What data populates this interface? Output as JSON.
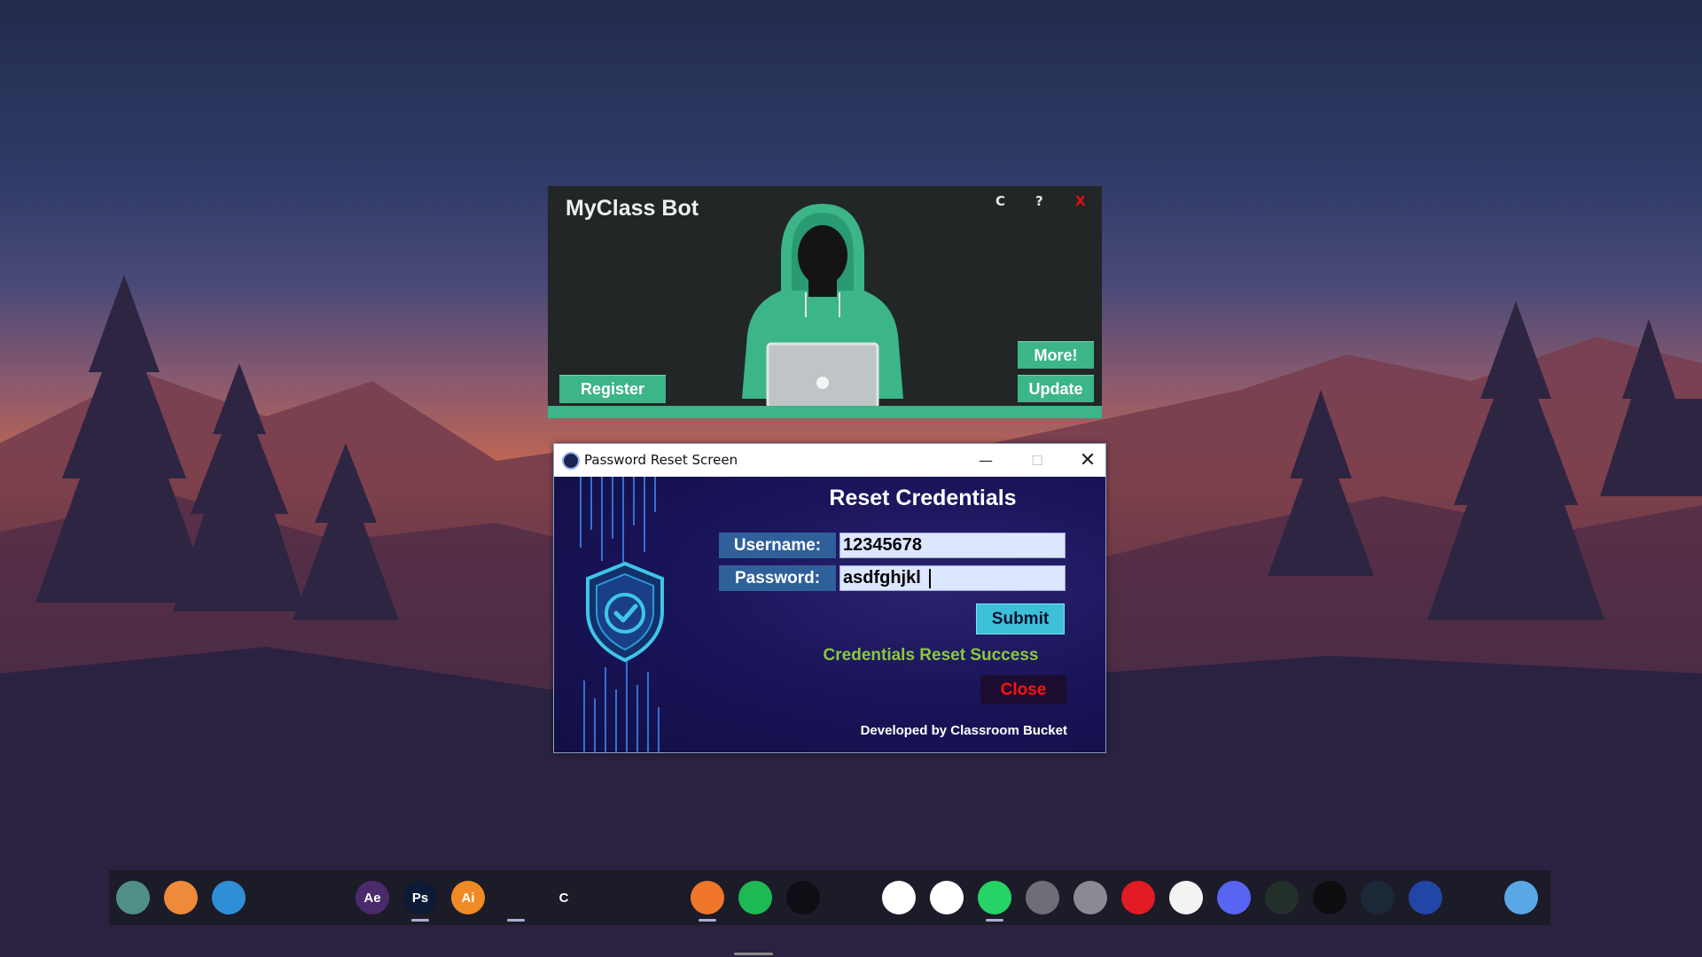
{
  "bot_window": {
    "title": "MyClass Bot",
    "controls": {
      "c": "C",
      "help": "?",
      "close": "X"
    },
    "buttons": {
      "register": "Register",
      "more": "More!",
      "update": "Update"
    },
    "accent": "#3cb589"
  },
  "reset_window": {
    "window_title": "Password Reset Screen",
    "heading": "Reset Credentials",
    "username_label": "Username:",
    "username_value": "12345678",
    "password_label": "Password:",
    "password_value": "asdfghjkl",
    "submit_label": "Submit",
    "status": "Credentials Reset Success",
    "close_label": "Close",
    "footer": "Developed by Classroom Bucket"
  },
  "dock": {
    "items": [
      {
        "name": "monitor-icon",
        "bg": "#4f8f86",
        "glyph": "",
        "active": false
      },
      {
        "name": "download-icon",
        "bg": "#ef8a3a",
        "glyph": "",
        "active": false
      },
      {
        "name": "photos-icon",
        "bg": "#2f8fd6",
        "glyph": "",
        "active": false
      },
      {
        "name": "user-icon",
        "bg": "#1c1b28",
        "glyph": "",
        "active": false
      },
      {
        "name": "user-alt-icon",
        "bg": "#1c1b28",
        "glyph": "",
        "active": false
      },
      {
        "name": "after-effects-icon",
        "bg": "#4a2a6a",
        "glyph": "Ae",
        "active": false
      },
      {
        "name": "photoshop-icon",
        "bg": "#0c1a36",
        "glyph": "Ps",
        "active": true
      },
      {
        "name": "illustrator-icon",
        "bg": "#f08a24",
        "glyph": "Ai",
        "active": false
      },
      {
        "name": "vscode-icon",
        "bg": "#1c1b28",
        "glyph": "",
        "active": true
      },
      {
        "name": "c-language-icon",
        "bg": "#1c1b28",
        "glyph": "C",
        "active": false
      },
      {
        "name": "pycharm-icon",
        "bg": "#1c1b28",
        "glyph": "",
        "active": false
      },
      {
        "name": "installer-icon",
        "bg": "#1c1b28",
        "glyph": "",
        "active": false
      },
      {
        "name": "firefox-icon",
        "bg": "#f0762a",
        "glyph": "",
        "active": true
      },
      {
        "name": "spotify-icon",
        "bg": "#1db954",
        "glyph": "",
        "active": false
      },
      {
        "name": "scrivener-icon",
        "bg": "#0e0e14",
        "glyph": "",
        "active": false
      },
      {
        "name": "todo-check-icon",
        "bg": "#1c1b28",
        "glyph": "",
        "active": false
      },
      {
        "name": "slack-icon",
        "bg": "#ffffff",
        "glyph": "",
        "active": false
      },
      {
        "name": "evernote-icon",
        "bg": "#ffffff",
        "glyph": "",
        "active": false
      },
      {
        "name": "whatsapp-icon",
        "bg": "#25d366",
        "glyph": "",
        "active": true
      },
      {
        "name": "gmail-icon",
        "bg": "#6e6e78",
        "glyph": "",
        "active": false
      },
      {
        "name": "camera-icon",
        "bg": "#8a8a92",
        "glyph": "",
        "active": false
      },
      {
        "name": "youtube-icon",
        "bg": "#e01b24",
        "glyph": "",
        "active": false
      },
      {
        "name": "scanner-icon",
        "bg": "#f2f2f2",
        "glyph": "",
        "active": false
      },
      {
        "name": "discord-icon",
        "bg": "#5865f2",
        "glyph": "",
        "active": false
      },
      {
        "name": "game-warrior-icon",
        "bg": "#23302a",
        "glyph": "",
        "active": false
      },
      {
        "name": "game-skull-icon",
        "bg": "#0e0e10",
        "glyph": "",
        "active": false
      },
      {
        "name": "steam-icon",
        "bg": "#1b2838",
        "glyph": "",
        "active": false
      },
      {
        "name": "settings-app-icon",
        "bg": "#2146a8",
        "glyph": "",
        "active": false
      },
      {
        "name": "archive-icon",
        "bg": "#1c1b28",
        "glyph": "",
        "active": false
      },
      {
        "name": "finder-icon",
        "bg": "#5aa7e6",
        "glyph": "",
        "active": false
      }
    ]
  }
}
